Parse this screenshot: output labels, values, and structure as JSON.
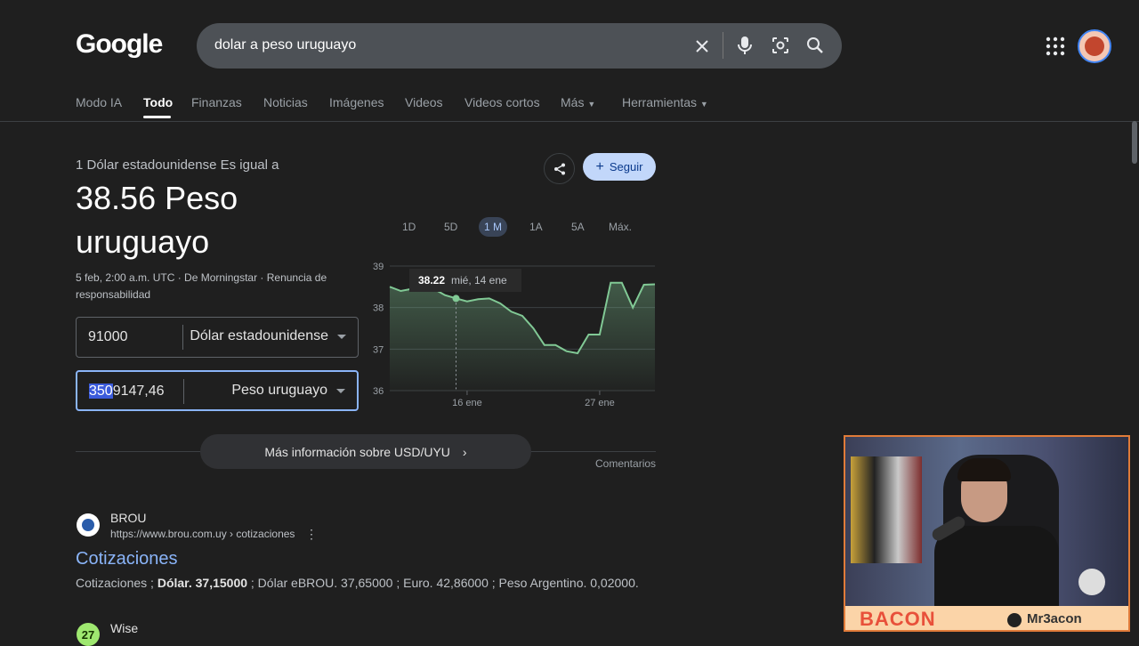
{
  "header": {
    "logo": "Google",
    "search_query": "dolar a peso uruguayo"
  },
  "tabs": [
    {
      "label": "Modo IA"
    },
    {
      "label": "Todo"
    },
    {
      "label": "Finanzas"
    },
    {
      "label": "Noticias"
    },
    {
      "label": "Imágenes"
    },
    {
      "label": "Videos"
    },
    {
      "label": "Videos cortos"
    },
    {
      "label": "Más"
    },
    {
      "label": "Herramientas"
    }
  ],
  "converter": {
    "subtitle": "1 Dólar estadounidense Es igual a",
    "result_line1": "38.56 Peso",
    "result_line2": "uruguayo",
    "meta": "5 feb, 2:00 a.m. UTC · De Morningstar · Renuncia de responsabilidad",
    "from_value": "91000",
    "from_currency": "Dólar estadounidense",
    "to_value_selected": "350",
    "to_value_rest": "9147,46",
    "to_currency": "Peso uruguayo",
    "follow_label": "Seguir"
  },
  "ranges": [
    "1D",
    "5D",
    "1 M",
    "1A",
    "5A",
    "Máx."
  ],
  "active_range": "1 M",
  "chart_data": {
    "type": "area",
    "ylim": [
      36,
      39
    ],
    "yticks": [
      "39",
      "38",
      "37",
      "36"
    ],
    "xticks": [
      "16 ene",
      "27 ene"
    ],
    "tooltip_value": "38.22",
    "tooltip_date": "mié, 14 ene",
    "values": [
      38.5,
      38.4,
      38.45,
      38.4,
      38.45,
      38.3,
      38.22,
      38.15,
      38.2,
      38.22,
      38.1,
      37.9,
      37.8,
      37.5,
      37.1,
      37.1,
      36.95,
      36.9,
      37.35,
      37.35,
      38.6,
      38.6,
      38.0,
      38.55,
      38.56
    ],
    "line_color": "#81c995"
  },
  "more_info": "Más información sobre USD/UYU",
  "comments": "Comentarios",
  "results": [
    {
      "site": "BROU",
      "url": "https://www.brou.com.uy › cotizaciones",
      "title": "Cotizaciones",
      "snippet_a": "Cotizaciones ; ",
      "snippet_b": "Dólar. 37,15000",
      "snippet_c": " ; Dólar eBROU. 37,65000 ; Euro. 42,86000 ; Peso Argentino. 0,02000."
    },
    {
      "site": "Wise",
      "favicon": "27"
    }
  ],
  "webcam": {
    "brand": "BACON",
    "handle": "Mr3acon"
  },
  "colors": {
    "background": "#1f1f1f",
    "link": "#8ab4f8",
    "accent_border": "#8ab4f8"
  }
}
